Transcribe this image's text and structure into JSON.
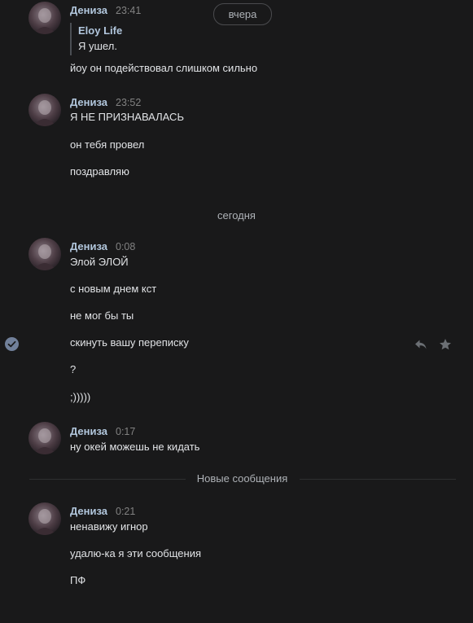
{
  "date_pill": "вчера",
  "date_separator_today": "сегодня",
  "new_messages_label": "Новые сообщения",
  "groups": [
    {
      "author": "Дениза",
      "time": "23:41",
      "quote": {
        "author": "Eloy Life",
        "text": "Я ушел."
      },
      "messages": [
        "йоу он подействовал слишком сильно"
      ]
    },
    {
      "author": "Дениза",
      "time": "23:52",
      "messages": [
        "Я НЕ ПРИЗНАВАЛАСЬ",
        "он тебя провел",
        "поздравляю"
      ]
    },
    {
      "author": "Дениза",
      "time": "0:08",
      "messages": [
        "Элой ЭЛОЙ",
        "с новым днем кст",
        "не мог бы ты",
        "скинуть вашу переписку",
        "?",
        ";)))))"
      ]
    },
    {
      "author": "Дениза",
      "time": "0:17",
      "messages": [
        "ну окей можешь не кидать"
      ]
    },
    {
      "author": "Дениза",
      "time": "0:21",
      "messages": [
        "ненавижу игнор",
        "удалю-ка я эти сообщения",
        "ПФ"
      ]
    }
  ],
  "icons": {
    "selected_check": "check-circle-icon",
    "reply": "reply-icon",
    "favorite": "star-icon"
  }
}
